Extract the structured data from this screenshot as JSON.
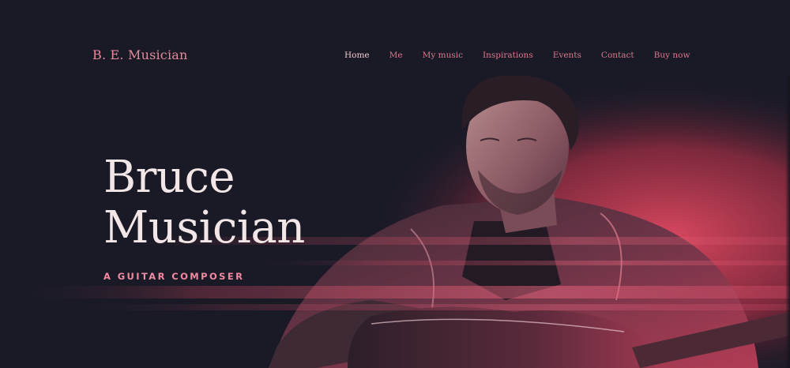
{
  "site": {
    "brand": "B. E. Musician"
  },
  "nav": {
    "items": [
      {
        "label": "Home",
        "active": true
      },
      {
        "label": "Me"
      },
      {
        "label": "My music"
      },
      {
        "label": "Inspirations"
      },
      {
        "label": "Events"
      },
      {
        "label": "Contact"
      },
      {
        "label": "Buy now"
      }
    ]
  },
  "hero": {
    "title_line1": "Bruce",
    "title_line2": "Musician",
    "subtitle": "A GUITAR COMPOSER"
  },
  "colors": {
    "background": "#191a26",
    "accent": "#d9566f",
    "brand": "#e38a9b",
    "title": "#f2e6e6"
  }
}
